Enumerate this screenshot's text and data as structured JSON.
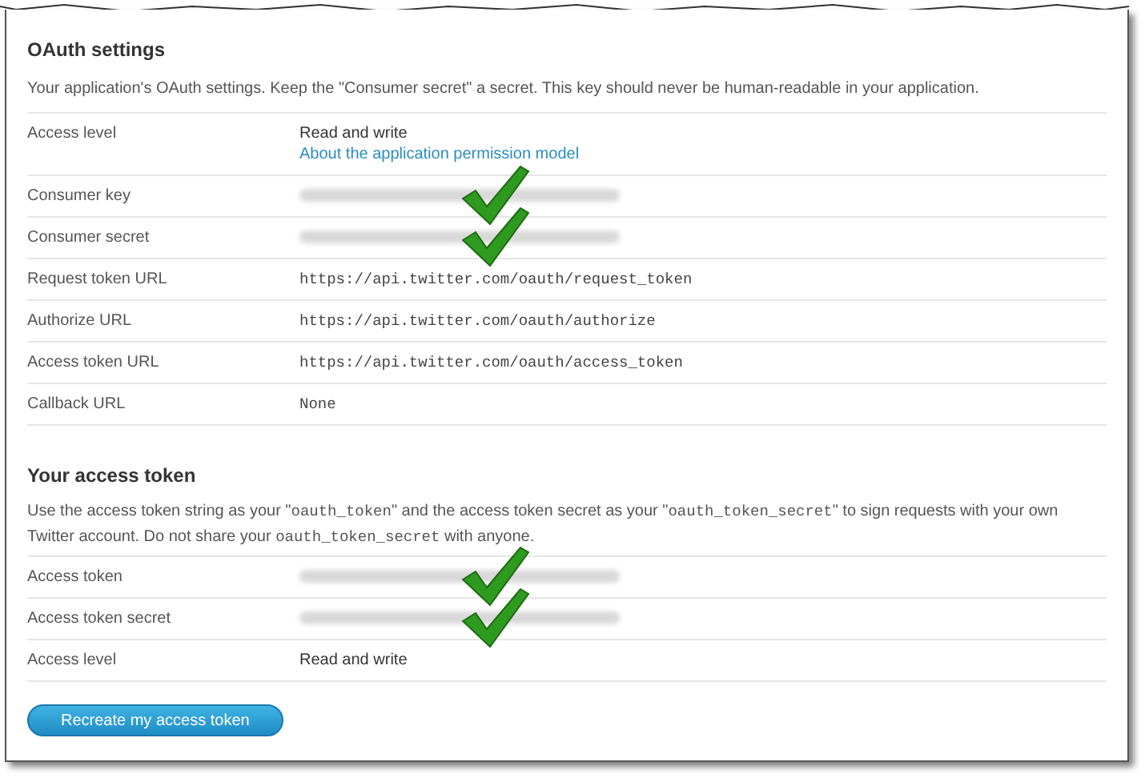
{
  "oauth_settings": {
    "title": "OAuth settings",
    "description": "Your application's OAuth settings. Keep the \"Consumer secret\" a secret. This key should never be human-readable in your application.",
    "rows": [
      {
        "label": "Access level",
        "kind": "text",
        "value": "Read and write",
        "link": "About the application permission model",
        "annotated": false
      },
      {
        "label": "Consumer key",
        "kind": "redacted",
        "annotated": true
      },
      {
        "label": "Consumer secret",
        "kind": "redacted",
        "annotated": true
      },
      {
        "label": "Request token URL",
        "kind": "mono",
        "value": "https://api.twitter.com/oauth/request_token",
        "annotated": false
      },
      {
        "label": "Authorize URL",
        "kind": "mono",
        "value": "https://api.twitter.com/oauth/authorize",
        "annotated": false
      },
      {
        "label": "Access token URL",
        "kind": "mono",
        "value": "https://api.twitter.com/oauth/access_token",
        "annotated": false
      },
      {
        "label": "Callback URL",
        "kind": "mono",
        "value": "None",
        "annotated": false
      }
    ]
  },
  "access_token": {
    "title": "Your access token",
    "description": [
      {
        "text": "Use the access token string as your \"",
        "code": false
      },
      {
        "text": "oauth_token",
        "code": true
      },
      {
        "text": "\" and the access token secret as your \"",
        "code": false
      },
      {
        "text": "oauth_token_secret",
        "code": true
      },
      {
        "text": "\" to sign requests with your own Twitter account. Do not share your ",
        "code": false
      },
      {
        "text": "oauth_token_secret",
        "code": true
      },
      {
        "text": " with anyone.",
        "code": false
      }
    ],
    "rows": [
      {
        "label": "Access token",
        "kind": "redacted",
        "annotated": true
      },
      {
        "label": "Access token secret",
        "kind": "redacted",
        "annotated": true
      },
      {
        "label": "Access level",
        "kind": "text",
        "value": "Read and write",
        "annotated": false
      }
    ],
    "button": "Recreate my access token"
  }
}
